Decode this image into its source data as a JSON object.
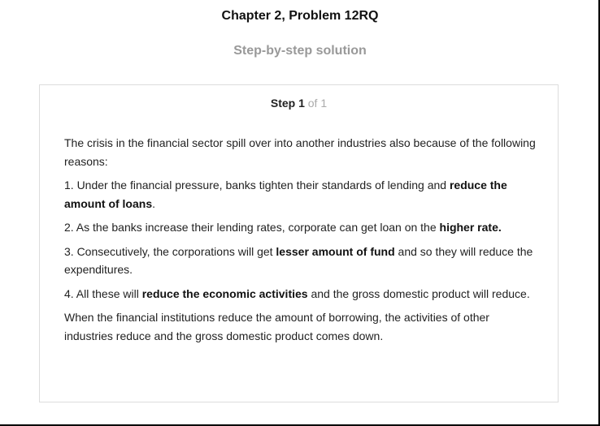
{
  "header": {
    "title": "Chapter 2, Problem 12RQ",
    "subtitle": "Step-by-step solution"
  },
  "step": {
    "label": "Step 1",
    "of": "of 1"
  },
  "content": {
    "intro": "The crisis in the financial sector spill over into another industries also because of the following reasons:",
    "p1_a": "1. Under the financial pressure, banks tighten their standards of lending and ",
    "p1_b": "reduce the amount of loans",
    "p1_c": ".",
    "p2_a": "2. As the banks increase their lending rates, corporate can get loan on the ",
    "p2_b": "higher rate.",
    "p3_a": "3. Consecutively, the corporations will get ",
    "p3_b": "lesser amount of fund",
    "p3_c": " and so they will reduce the expenditures.",
    "p4_a": "4. All these will ",
    "p4_b": "reduce the economic activities",
    "p4_c": " and the gross domestic product will reduce.",
    "conclusion": "When the financial institutions reduce the amount of borrowing, the activities of other industries reduce and the gross domestic product comes down."
  }
}
